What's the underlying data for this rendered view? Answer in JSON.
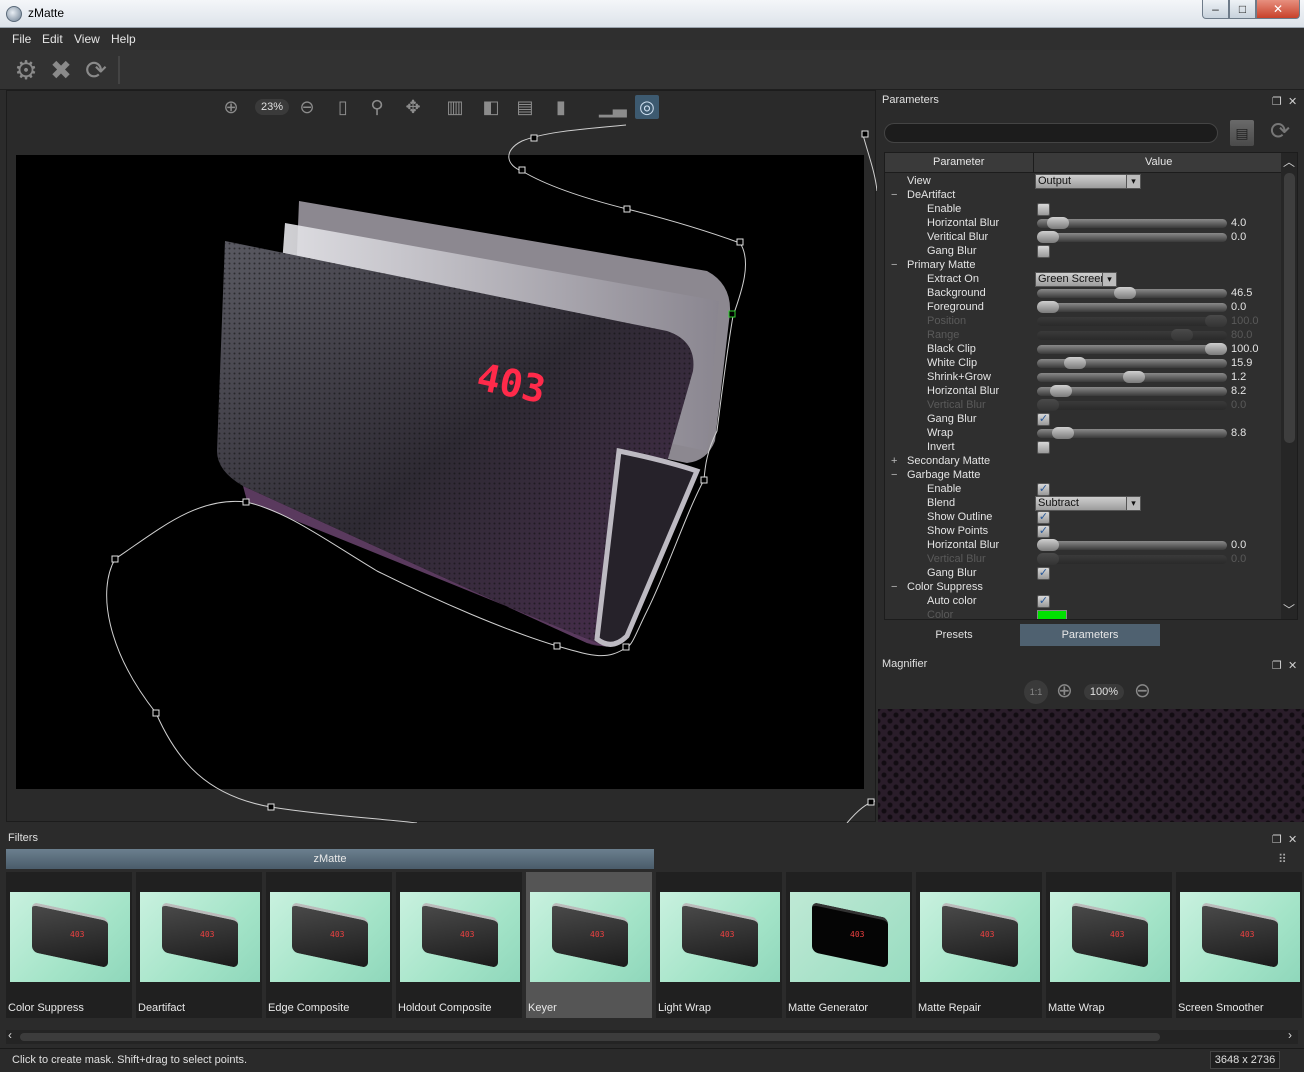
{
  "window": {
    "title": "zMatte",
    "min": "–",
    "max": "□",
    "close": "✕"
  },
  "menu": [
    "File",
    "Edit",
    "View",
    "Help"
  ],
  "viewer": {
    "zoom": "23%"
  },
  "parameters": {
    "title": "Parameters",
    "col_parameter": "Parameter",
    "col_value": "Value",
    "tabs": {
      "presets": "Presets",
      "parameters": "Parameters"
    },
    "rows": [
      {
        "type": "combo",
        "indent": 1,
        "label": "View",
        "value": "Output"
      },
      {
        "type": "group",
        "label": "DeArtifact",
        "expander": "−"
      },
      {
        "type": "check",
        "indent": 2,
        "label": "Enable",
        "checked": false
      },
      {
        "type": "slider",
        "indent": 2,
        "label": "Horizontal Blur",
        "value": "4.0",
        "pos": 0.06
      },
      {
        "type": "slider",
        "indent": 2,
        "label": "Veritical Blur",
        "value": "0.0",
        "pos": 0.0
      },
      {
        "type": "check",
        "indent": 2,
        "label": "Gang Blur",
        "checked": false
      },
      {
        "type": "group",
        "label": "Primary Matte",
        "expander": "−"
      },
      {
        "type": "combo",
        "indent": 2,
        "label": "Extract On",
        "value": "Green Screen"
      },
      {
        "type": "slider",
        "indent": 2,
        "label": "Background",
        "value": "46.5",
        "pos": 0.46
      },
      {
        "type": "slider",
        "indent": 2,
        "label": "Foreground",
        "value": "0.0",
        "pos": 0.0
      },
      {
        "type": "slider",
        "indent": 2,
        "label": "Position",
        "value": "100.0",
        "pos": 1.0,
        "dim": true
      },
      {
        "type": "slider",
        "indent": 2,
        "label": "Range",
        "value": "80.0",
        "pos": 0.8,
        "dim": true
      },
      {
        "type": "slider",
        "indent": 2,
        "label": "Black Clip",
        "value": "100.0",
        "pos": 1.0
      },
      {
        "type": "slider",
        "indent": 2,
        "label": "White Clip",
        "value": "15.9",
        "pos": 0.16
      },
      {
        "type": "slider",
        "indent": 2,
        "label": "Shrink+Grow",
        "value": "1.2",
        "pos": 0.51
      },
      {
        "type": "slider",
        "indent": 2,
        "label": "Horizontal Blur",
        "value": "8.2",
        "pos": 0.08
      },
      {
        "type": "slider",
        "indent": 2,
        "label": "Vertical Blur",
        "value": "0.0",
        "pos": 0.0,
        "dim": true
      },
      {
        "type": "check",
        "indent": 2,
        "label": "Gang Blur",
        "checked": true
      },
      {
        "type": "slider",
        "indent": 2,
        "label": "Wrap",
        "value": "8.8",
        "pos": 0.09
      },
      {
        "type": "check",
        "indent": 2,
        "label": "Invert",
        "checked": false
      },
      {
        "type": "group",
        "label": "Secondary Matte",
        "expander": "+"
      },
      {
        "type": "group",
        "label": "Garbage Matte",
        "expander": "−"
      },
      {
        "type": "check",
        "indent": 2,
        "label": "Enable",
        "checked": true
      },
      {
        "type": "combo",
        "indent": 2,
        "label": "Blend",
        "value": "Subtract"
      },
      {
        "type": "check",
        "indent": 2,
        "label": "Show Outline",
        "checked": true
      },
      {
        "type": "check",
        "indent": 2,
        "label": "Show Points",
        "checked": true
      },
      {
        "type": "slider",
        "indent": 2,
        "label": "Horizontal Blur",
        "value": "0.0",
        "pos": 0.0
      },
      {
        "type": "slider",
        "indent": 2,
        "label": "Vertical Blur",
        "value": "0.0",
        "pos": 0.0,
        "dim": true
      },
      {
        "type": "check",
        "indent": 2,
        "label": "Gang Blur",
        "checked": true
      },
      {
        "type": "group",
        "label": "Color Suppress",
        "expander": "−"
      },
      {
        "type": "check",
        "indent": 2,
        "label": "Auto color",
        "checked": true
      },
      {
        "type": "color",
        "indent": 2,
        "label": "Color",
        "color": "#00e000",
        "dim": true
      }
    ]
  },
  "magnifier": {
    "title": "Magnifier",
    "zoom": "100%",
    "one_to_one": "1:1"
  },
  "filters": {
    "title": "Filters",
    "tab": "zMatte",
    "selected_index": 4,
    "items": [
      "Color Suppress",
      "Deartifact",
      "Edge Composite",
      "Holdout Composite",
      "Keyer",
      "Light Wrap",
      "Matte Generator",
      "Matte Repair",
      "Matte Wrap",
      "Screen Smoother"
    ],
    "led_text": "403"
  },
  "status": {
    "message": "Click to create mask. Shift+drag to select points.",
    "dimensions": "3648 x 2736"
  },
  "colors": {
    "accent_tab": "#4f6170",
    "filter_tab": "#5d7080",
    "mask_point_selected": "#2fd12f"
  }
}
